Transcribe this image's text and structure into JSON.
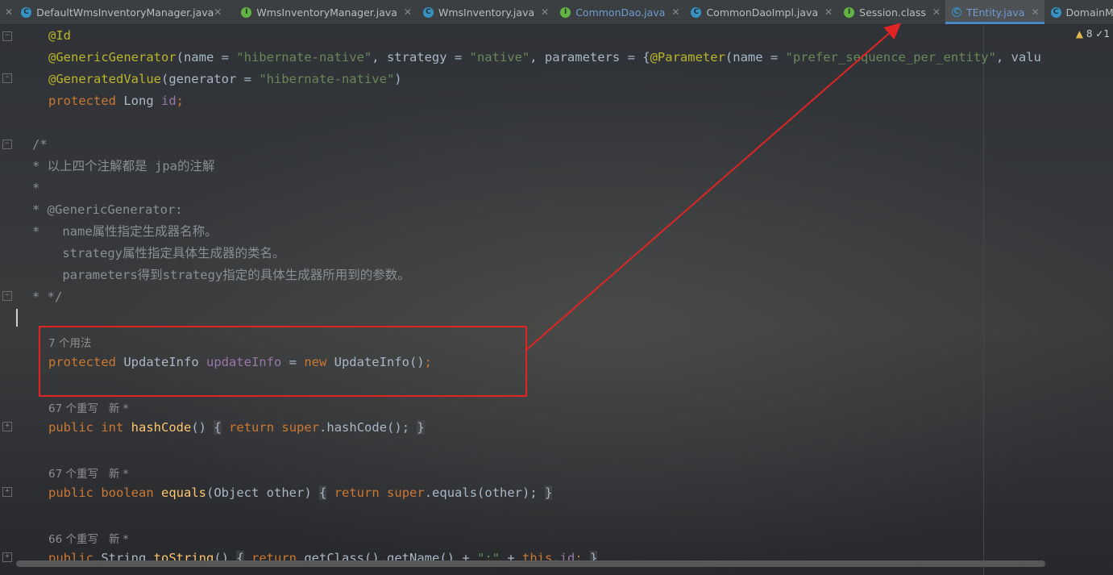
{
  "tabs": [
    {
      "label": "DefaultWmsInventoryManager.java",
      "type": "c",
      "active": false
    },
    {
      "label": "WmsInventoryManager.java",
      "type": "i",
      "active": false
    },
    {
      "label": "WmsInventory.java",
      "type": "c",
      "active": false
    },
    {
      "label": "CommonDao.java",
      "type": "i",
      "active": false
    },
    {
      "label": "CommonDaoImpl.java",
      "type": "c",
      "active": false
    },
    {
      "label": "Session.class",
      "type": "i",
      "active": false
    },
    {
      "label": "TEntity.java",
      "type": "cls",
      "active": true
    },
    {
      "label": "DomainModel.java",
      "type": "c",
      "active": false
    }
  ],
  "inspection": {
    "warnings": "8",
    "ok": "1"
  },
  "code": {
    "l1": "@Id",
    "l2_ann": "@GenericGenerator",
    "l2_a": "(name = ",
    "l2_s1": "\"hibernate-native\"",
    "l2_b": ", strategy = ",
    "l2_s2": "\"native\"",
    "l2_c": ", parameters = {",
    "l2_ann2": "@Parameter",
    "l2_d": "(name = ",
    "l2_s3": "\"prefer_sequence_per_entity\"",
    "l2_e": ", valu",
    "l3_ann": "@GeneratedValue",
    "l3_a": "(generator = ",
    "l3_s": "\"hibernate-native\"",
    "l3_b": ")",
    "l4_kw": "protected",
    "l4_t": " Long ",
    "l4_f": "id",
    "l4_e": ";",
    "c1": "/*",
    "c2": "* 以上四个注解都是 jpa的注解",
    "c3": "*",
    "c4": "* @GenericGenerator:",
    "c5": "*   name属性指定生成器名称。",
    "c6": "    strategy属性指定具体生成器的类名。",
    "c7": "    parameters得到strategy指定的具体生成器所用到的参数。",
    "c8": "* */",
    "hint_usages": "7 个用法",
    "u_kw": "protected",
    "u_t": " UpdateInfo ",
    "u_f": "updateInfo",
    "u_a": " = ",
    "u_kw2": "new",
    "u_b": " UpdateInfo()",
    "u_e": ";",
    "hint_hash": "67 个重写   新 *",
    "h_kw": "public int",
    "h_sp": " ",
    "h_fn": "hashCode",
    "h_p": "()",
    "h_ob": "{",
    "h_kw2": "return",
    "h_sup": "super",
    "h_call": ".hashCode();",
    "h_cb": "}",
    "hint_equals": "67 个重写   新 *",
    "e_kw": "public boolean",
    "e_fn": "equals",
    "e_p": "(Object other)",
    "e_ob": "{",
    "e_kw2": "return",
    "e_sup": "super",
    "e_call": ".equals(other);",
    "e_cb": "}",
    "hint_tostring": "66 个重写   新 *",
    "t_kw": "public",
    "t_ty": " String ",
    "t_fn": "toString",
    "t_p": "()",
    "t_ob": "{",
    "t_kw2": "return",
    "t_call": " getClass().getName() + ",
    "t_s": "\":\"",
    "t_plus": " + ",
    "t_this": "this",
    "t_dot": ".",
    "t_f": "id",
    "t_e": ";",
    "t_cb": "}"
  },
  "annotation": {
    "highlight_color": "#e02424"
  }
}
